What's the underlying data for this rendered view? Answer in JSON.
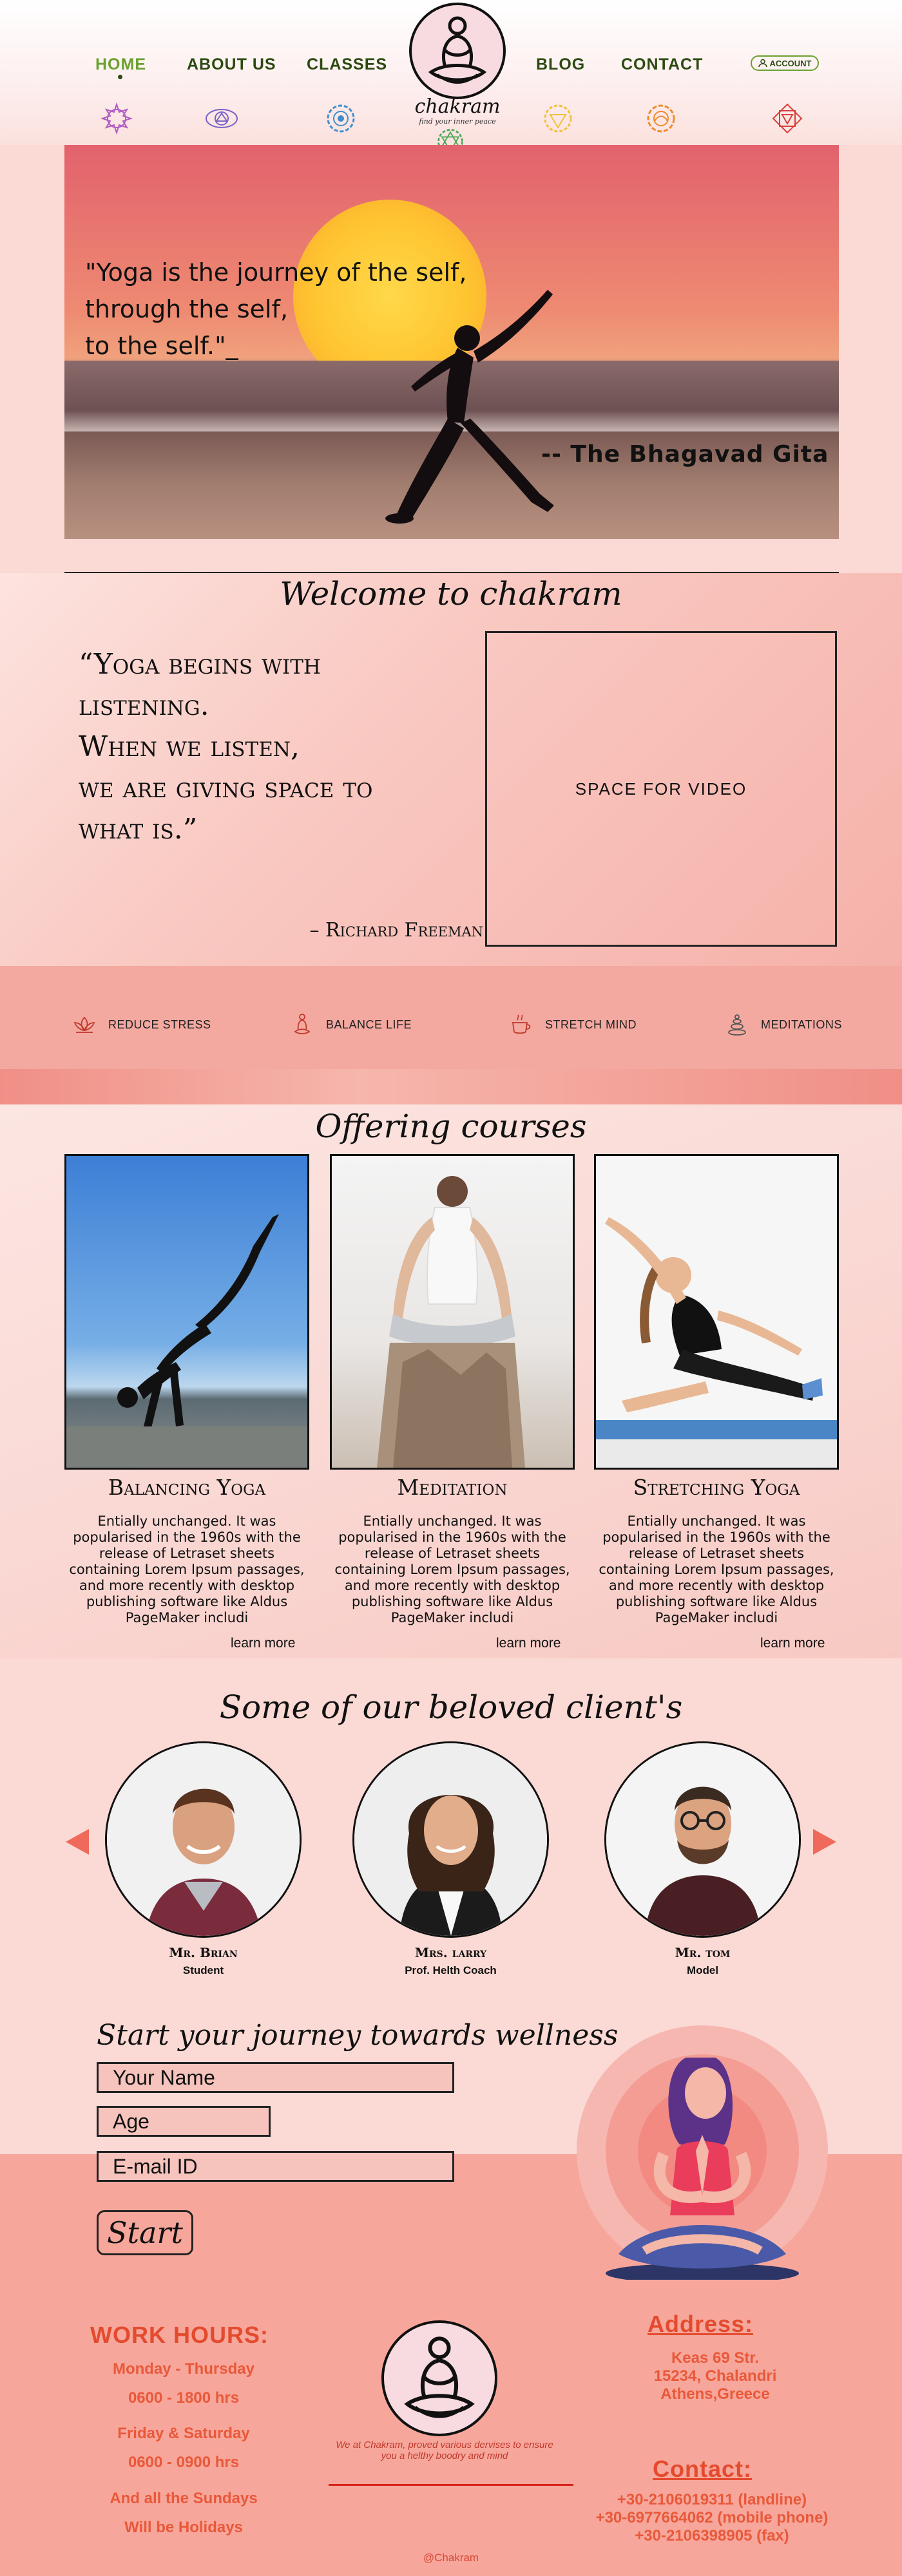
{
  "nav": {
    "items": [
      {
        "label": "HOME"
      },
      {
        "label": "ABOUT US"
      },
      {
        "label": "CLASSES"
      },
      {
        "label": "BLOG"
      },
      {
        "label": "CONTACT"
      }
    ],
    "account_label": "ACCOUNT"
  },
  "logo": {
    "text": "chakram",
    "tagline": "find your inner peace"
  },
  "hero": {
    "quote_lines": [
      "\"Yoga is the journey of the self,",
      "through the self,",
      "to the self.\"_"
    ],
    "author": "-- The Bhagavad Gita"
  },
  "welcome": {
    "title": "Welcome to chakram",
    "quote_lines": [
      "“Yoga begins with",
      "listening.",
      "When we listen,",
      "we are giving space to",
      "what is.”"
    ],
    "attribution": "– Richard Freeman",
    "video_placeholder": "SPACE FOR VIDEO"
  },
  "benefits": [
    {
      "label": "REDUCE STRESS",
      "icon": "lotus-icon"
    },
    {
      "label": "BALANCE LIFE",
      "icon": "meditating-person-icon"
    },
    {
      "label": "STRETCH MIND",
      "icon": "tea-cup-icon"
    },
    {
      "label": "MEDITATIONS",
      "icon": "stacked-stones-icon"
    }
  ],
  "courses": {
    "title": "Offering courses",
    "items": [
      {
        "title": "Balancing Yoga",
        "description": "Entially unchanged. It was popularised in the 1960s with the release of Letraset sheets containing Lorem Ipsum passages, and more recently with desktop publishing software like Aldus PageMaker includi",
        "more": "learn more"
      },
      {
        "title": "Meditation",
        "description": "Entially unchanged. It was popularised in the 1960s with the release of Letraset sheets containing Lorem Ipsum passages, and more recently with desktop publishing software like Aldus PageMaker includi",
        "more": "learn more"
      },
      {
        "title": "Stretching Yoga",
        "description": "Entially unchanged. It was popularised in the 1960s with the release of Letraset sheets containing Lorem Ipsum passages, and more recently with desktop publishing software like Aldus PageMaker includi",
        "more": "learn more"
      }
    ]
  },
  "clients": {
    "title": "Some of our beloved client's",
    "items": [
      {
        "name": "Mr. Brian",
        "role": "Student"
      },
      {
        "name": "Mrs. larry",
        "role": "Prof. Helth Coach"
      },
      {
        "name": "Mr. tom",
        "role": "Model"
      }
    ]
  },
  "journey": {
    "title": "Start your journey towards wellness",
    "fields": {
      "name": "Your Name",
      "age": "Age",
      "email": "E-mail ID"
    },
    "start_label": "Start"
  },
  "footer": {
    "hours_title": "WORK HOURS:",
    "hours_lines": [
      "Monday - Thursday",
      "0600 - 1800 hrs",
      "Friday & Saturday",
      "0600 - 0900 hrs",
      "And all the Sundays",
      "Will be Holidays"
    ],
    "mission": "We at Chakram, proved various dervises to ensure you a helthy boodry and mind",
    "address_title": "Address:",
    "address_lines": [
      "Keas 69 Str.",
      "15234, Chalandri",
      "Athens,Greece"
    ],
    "contact_title": "Contact:",
    "contact_lines": [
      "+30-2106019311 (landline)",
      "+30-6977664062 (mobile phone)",
      "+30-2106398905 (fax)"
    ],
    "copyright": "@Chakram"
  },
  "colors": {
    "nav_text": "#2c4a10",
    "nav_active": "#6aa12f",
    "footer_accent": "#e34b2e",
    "page_bg": "#fbd9d4"
  }
}
